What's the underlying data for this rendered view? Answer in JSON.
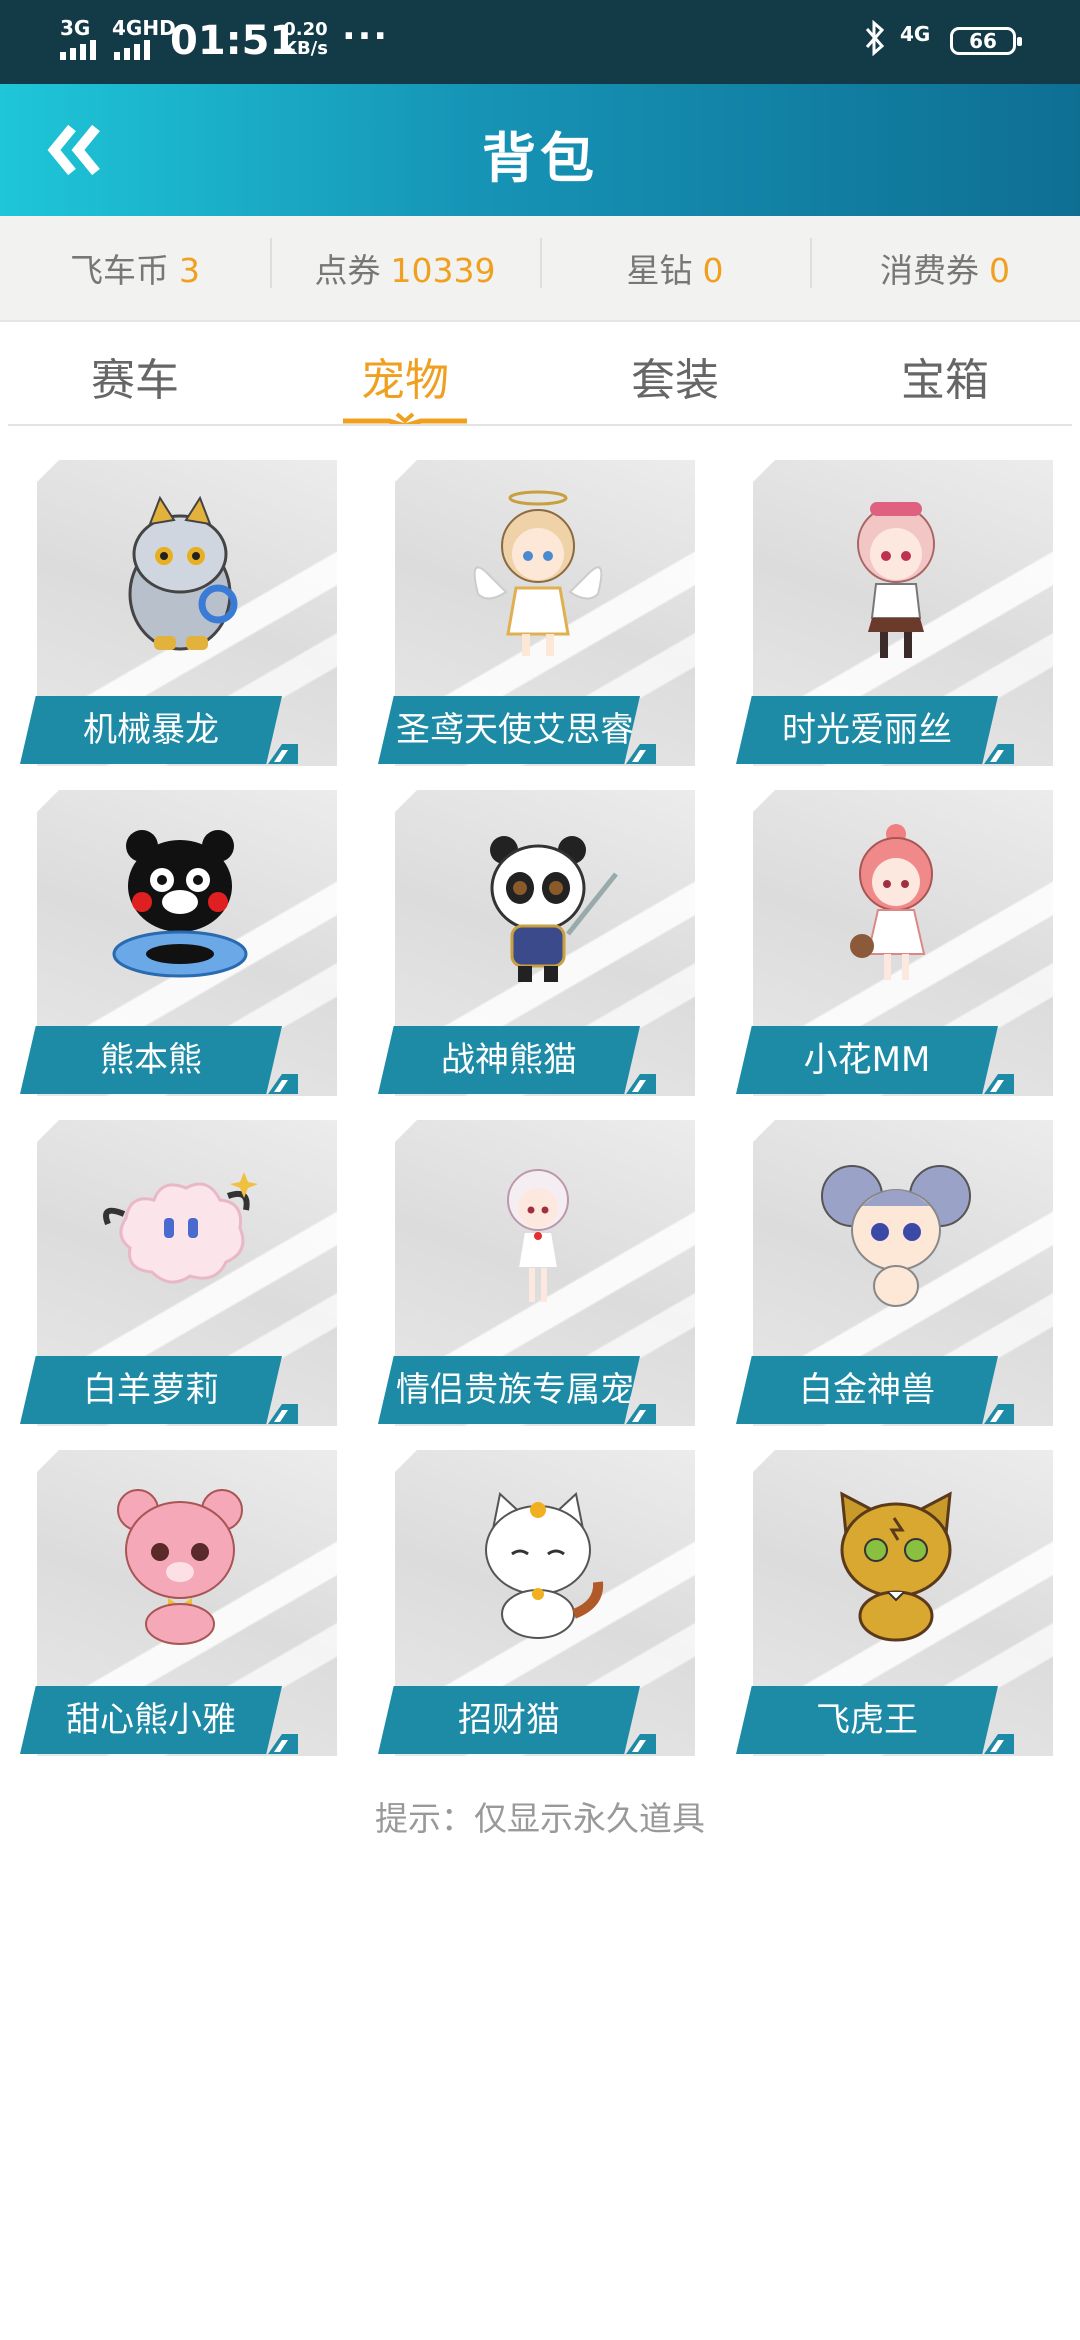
{
  "status_bar": {
    "signal1": "3G",
    "signal2": "4GHD",
    "time": "01:51",
    "speed_value": "0.20",
    "speed_unit": "KB/s",
    "dots": "···",
    "network": "4G",
    "battery": "66"
  },
  "header": {
    "title": "背包"
  },
  "currency": [
    {
      "label": "飞车币",
      "value": "3"
    },
    {
      "label": "点券",
      "value": "10339"
    },
    {
      "label": "星钻",
      "value": "0"
    },
    {
      "label": "消费券",
      "value": "0"
    }
  ],
  "tabs": [
    {
      "label": "赛车",
      "active": false
    },
    {
      "label": "宠物",
      "active": true
    },
    {
      "label": "套装",
      "active": false
    },
    {
      "label": "宝箱",
      "active": false
    }
  ],
  "pets": [
    {
      "name": "机械暴龙",
      "icon": "mech-dragon-icon"
    },
    {
      "name": "圣鸢天使艾思睿",
      "icon": "angel-girl-icon"
    },
    {
      "name": "时光爱丽丝",
      "icon": "alice-girl-icon"
    },
    {
      "name": "熊本熊",
      "icon": "kumamon-bear-icon"
    },
    {
      "name": "战神熊猫",
      "icon": "warrior-panda-icon"
    },
    {
      "name": "小花MM",
      "icon": "pink-girl-icon"
    },
    {
      "name": "白羊萝莉",
      "icon": "sheep-cloud-icon"
    },
    {
      "name": "情侣贵族专属宠",
      "icon": "noble-girl-icon"
    },
    {
      "name": "白金神兽",
      "icon": "mouse-beast-icon"
    },
    {
      "name": "甜心熊小雅",
      "icon": "pink-bear-icon"
    },
    {
      "name": "招财猫",
      "icon": "lucky-cat-icon"
    },
    {
      "name": "飞虎王",
      "icon": "tiger-king-icon"
    }
  ],
  "hint": "提示：仅显示永久道具",
  "colors": {
    "accent": "#f0a020",
    "label_bg": "#1d8aa6",
    "header_start": "#1ec6d8",
    "header_end": "#0e6f93"
  }
}
